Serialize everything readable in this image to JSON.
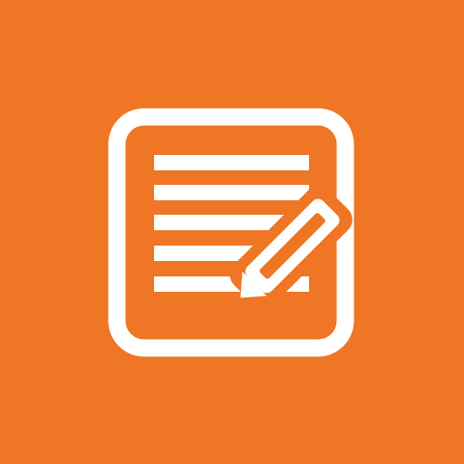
{
  "app": {
    "icon": "notes-edit-icon",
    "background_color": "#ee7624",
    "foreground_color": "#ffffff"
  }
}
